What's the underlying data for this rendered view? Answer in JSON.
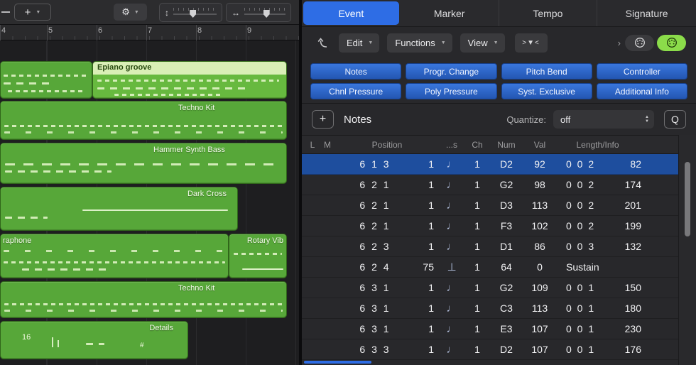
{
  "colors": {
    "accent_blue": "#2e6de5",
    "region_green": "#57a739",
    "selected_row": "#1e4e9e",
    "midi_green": "#8bdc4a"
  },
  "track_area": {
    "toolbar": {
      "add_label": "+",
      "chevron": "▼",
      "gear_icon": "⚙",
      "vzoom_icon": "↕",
      "hzoom_icon": "↔"
    },
    "ruler_marks": [
      "4",
      "5",
      "6",
      "7",
      "8",
      "9"
    ],
    "regions": {
      "epiano": {
        "label": "Epiano groove"
      },
      "techno_1": {
        "label": "Techno Kit"
      },
      "hammer": {
        "label": "Hammer Synth Bass"
      },
      "dark_cross": {
        "label": "Dark Cross"
      },
      "vibraphone": {
        "label": "raphone"
      },
      "rotary": {
        "label": "Rotary Vib"
      },
      "techno_2": {
        "label": "Techno Kit"
      },
      "details": {
        "label": "Details",
        "count": "16",
        "glyph": "#"
      }
    }
  },
  "event_editor": {
    "tabs": [
      {
        "label": "Event",
        "active": true
      },
      {
        "label": "Marker",
        "active": false
      },
      {
        "label": "Tempo",
        "active": false
      },
      {
        "label": "Signature",
        "active": false
      }
    ],
    "toolbar": {
      "menus": [
        "Edit",
        "Functions",
        "View"
      ],
      "menu_chevron": "▼",
      "filter_button": ">▼<",
      "pill_chevron": "›"
    },
    "filters": [
      "Notes",
      "Progr. Change",
      "Pitch Bend",
      "Controller",
      "Chnl Pressure",
      "Poly Pressure",
      "Syst. Exclusive",
      "Additional Info"
    ],
    "list_header": {
      "add_button": "+",
      "title": "Notes",
      "quantize_label": "Quantize:",
      "quantize_value": "off",
      "q_button": "Q"
    },
    "columns": [
      "L",
      "M",
      "Position",
      "...s",
      "Ch",
      "Num",
      "Val",
      "Length/Info"
    ],
    "status_glyphs": {
      "note": "♩",
      "pedal": "⊥"
    },
    "rows": [
      {
        "position": "6 1 3",
        "tick": "1",
        "status": "note",
        "ch": "1",
        "num": "D2",
        "val": "92",
        "len": "0 0 2",
        "info": "82",
        "selected": true
      },
      {
        "position": "6 2 1",
        "tick": "1",
        "status": "note",
        "ch": "1",
        "num": "G2",
        "val": "98",
        "len": "0 0 2",
        "info": "174"
      },
      {
        "position": "6 2 1",
        "tick": "1",
        "status": "note",
        "ch": "1",
        "num": "D3",
        "val": "113",
        "len": "0 0 2",
        "info": "201"
      },
      {
        "position": "6 2 1",
        "tick": "1",
        "status": "note",
        "ch": "1",
        "num": "F3",
        "val": "102",
        "len": "0 0 2",
        "info": "199"
      },
      {
        "position": "6 2 3",
        "tick": "1",
        "status": "note",
        "ch": "1",
        "num": "D1",
        "val": "86",
        "len": "0 0 3",
        "info": "132"
      },
      {
        "position": "6 2 4",
        "tick": "75",
        "status": "pedal",
        "ch": "1",
        "num": "64",
        "val": "0",
        "len": "Sustain",
        "info": ""
      },
      {
        "position": "6 3 1",
        "tick": "1",
        "status": "note",
        "ch": "1",
        "num": "G2",
        "val": "109",
        "len": "0 0 1",
        "info": "150"
      },
      {
        "position": "6 3 1",
        "tick": "1",
        "status": "note",
        "ch": "1",
        "num": "C3",
        "val": "113",
        "len": "0 0 1",
        "info": "180"
      },
      {
        "position": "6 3 1",
        "tick": "1",
        "status": "note",
        "ch": "1",
        "num": "E3",
        "val": "107",
        "len": "0 0 1",
        "info": "230"
      },
      {
        "position": "6 3 3",
        "tick": "1",
        "status": "note",
        "ch": "1",
        "num": "D2",
        "val": "107",
        "len": "0 0 1",
        "info": "176"
      }
    ]
  }
}
